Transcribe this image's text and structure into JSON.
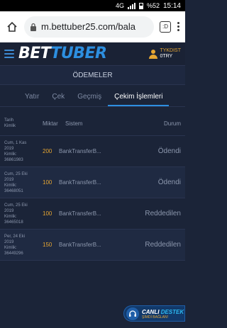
{
  "status_bar": {
    "network": "4G",
    "battery": "%52",
    "time": "15:14"
  },
  "browser": {
    "url": "m.bettuber25.com/bala",
    "tabs_count": ":D"
  },
  "header": {
    "logo_part1": "BET",
    "logo_part2": "TUBER",
    "user_line1": "TYKDIST",
    "user_line2": "0TRY"
  },
  "section_title": "ÖDEMELER",
  "tabs": [
    {
      "label": "Yatır",
      "active": false
    },
    {
      "label": "Çek",
      "active": false
    },
    {
      "label": "Geçmiş",
      "active": false
    },
    {
      "label": "Çekim İşlemleri",
      "active": true
    }
  ],
  "table": {
    "headers": {
      "date_line1": "Tarih",
      "date_line2": "Kimlik",
      "amount": "Miktar",
      "system": "Sistem",
      "status": "Durum"
    },
    "rows": [
      {
        "date_line1": "Cum, 1 Kas",
        "date_line2": "2019",
        "date_line3": "Kimlik:",
        "date_line4": "36861983",
        "amount": "200",
        "system": "BankTransferB...",
        "status": "Ödendi"
      },
      {
        "date_line1": "Cum, 25 Eki",
        "date_line2": "2019",
        "date_line3": "Kimlik:",
        "date_line4": "36468051",
        "amount": "100",
        "system": "BankTransferB...",
        "status": "Ödendi"
      },
      {
        "date_line1": "Cum, 25 Eki",
        "date_line2": "2019",
        "date_line3": "Kimlik:",
        "date_line4": "36465018",
        "amount": "100",
        "system": "BankTransferB...",
        "status": "Reddedilen"
      },
      {
        "date_line1": "Per, 24 Eki",
        "date_line2": "2019",
        "date_line3": "Kimlik:",
        "date_line4": "36449296",
        "amount": "150",
        "system": "BankTransferB...",
        "status": "Reddedilen"
      }
    ]
  },
  "live_support": {
    "title_part1": "CANLI",
    "title_part2": "DESTEK",
    "subtitle": "ŞİMDİ BAĞLAN!"
  },
  "colors": {
    "background": "#1b2438",
    "accent": "#2d8fe0",
    "amount": "#e6a632"
  }
}
